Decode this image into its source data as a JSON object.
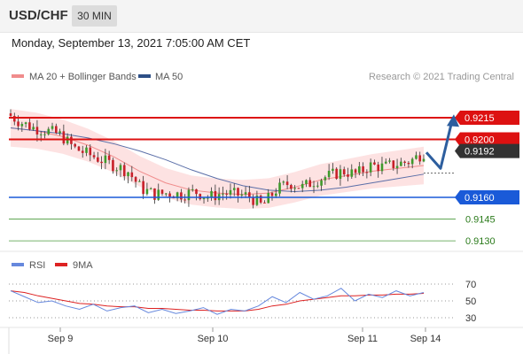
{
  "header": {
    "symbol": "USD/CHF",
    "timeframe": "30 MIN",
    "datetime": "Monday, September 13, 2021 7:05:00 AM CET"
  },
  "legend": {
    "bollinger": "MA 20 + Bollinger Bands",
    "ma50": "MA 50",
    "credit": "Research © 2021 Trading Central",
    "rsi": "RSI",
    "ma9": "9MA"
  },
  "colors": {
    "bollinger_fill": "#fde2e2",
    "bollinger_line": "#f08c8c",
    "ma50": "#5b6fa8",
    "resistance": "#dd1111",
    "support": "#1a5ad8",
    "target_line": "#4a9a3c",
    "target_text": "#2a7a1a",
    "current_price_bg": "#333333",
    "arrow": "#2d5e9e",
    "candle_up": "#3f9a2c",
    "candle_down": "#c8202a",
    "rsi": "#6688dd",
    "rsi_ma": "#dd2222"
  },
  "chart_data": [
    {
      "type": "line",
      "title": "",
      "levels": {
        "resistance": [
          0.9215,
          0.92
        ],
        "current": 0.9192,
        "support": [
          0.916
        ],
        "targets": [
          0.9145,
          0.913
        ]
      },
      "level_labels": [
        "0.9215",
        "0.9200",
        "0.9192",
        "0.9160",
        "0.9145",
        "0.9130"
      ],
      "x_tick_labels": [
        "Sep 9",
        "Sep 10",
        "Sep 11",
        "Sep 14"
      ],
      "series": [
        {
          "name": "MA 50",
          "values": [
            0.9208,
            0.9206,
            0.9204,
            0.9201,
            0.9197,
            0.9192,
            0.9186,
            0.9179,
            0.9173,
            0.9168,
            0.9165,
            0.9164,
            0.9165,
            0.9167,
            0.917,
            0.9173,
            0.9176
          ]
        },
        {
          "name": "MA 20 + Bollinger Bands",
          "values": [
            0.9208,
            0.9206,
            0.9202,
            0.9196,
            0.9188,
            0.9178,
            0.917,
            0.9165,
            0.9163,
            0.9162,
            0.9163,
            0.9167,
            0.9172,
            0.9175,
            0.9178,
            0.918,
            0.9182
          ]
        }
      ],
      "price_path": [
        0.9218,
        0.9212,
        0.9208,
        0.9206,
        0.9203,
        0.9194,
        0.919,
        0.9186,
        0.9182,
        0.9178,
        0.9166,
        0.9162,
        0.9163,
        0.9162,
        0.9164,
        0.916,
        0.9163,
        0.9162,
        0.9161,
        0.9154,
        0.9165,
        0.917,
        0.9167,
        0.9172,
        0.9175,
        0.9178,
        0.9176,
        0.9182,
        0.9181,
        0.9183,
        0.9185,
        0.9191
      ],
      "forecast_path": [
        0.9191,
        0.918,
        0.9213
      ]
    },
    {
      "type": "line",
      "title": "",
      "levels": [
        70,
        50,
        30
      ],
      "level_labels": [
        "70",
        "50",
        "30"
      ],
      "series": [
        {
          "name": "RSI",
          "values": [
            62,
            55,
            48,
            50,
            44,
            40,
            46,
            38,
            42,
            44,
            36,
            40,
            35,
            38,
            42,
            34,
            40,
            38,
            44,
            55,
            48,
            60,
            52,
            56,
            65,
            50,
            58,
            54,
            62,
            56,
            60
          ]
        },
        {
          "name": "9MA",
          "values": [
            62,
            60,
            56,
            53,
            50,
            47,
            46,
            44,
            43,
            43,
            41,
            41,
            40,
            39,
            39,
            38,
            38,
            38,
            40,
            44,
            46,
            50,
            52,
            54,
            56,
            56,
            57,
            57,
            58,
            58,
            59
          ]
        }
      ]
    }
  ]
}
